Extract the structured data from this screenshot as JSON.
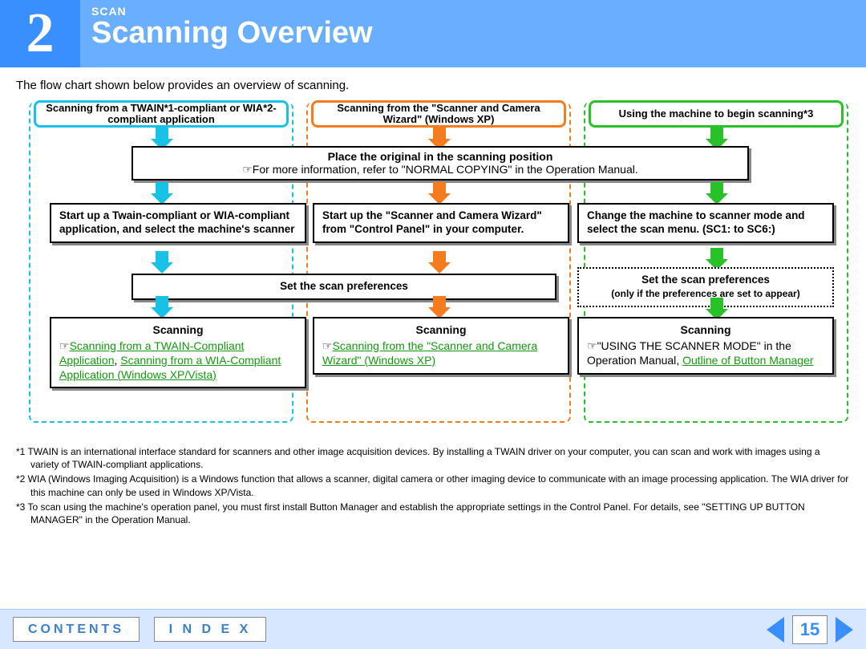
{
  "header": {
    "chapter_number": "2",
    "section": "SCAN",
    "title": "Scanning Overview"
  },
  "intro": "The flow chart shown below provides an overview of scanning.",
  "columns": {
    "col1_title": "Scanning from a TWAIN*1-compliant or WIA*2-compliant application",
    "col2_title": "Scanning from the \"Scanner and Camera Wizard\" (Windows XP)",
    "col3_title": "Using the machine to begin scanning*3"
  },
  "place": {
    "bold": "Place the original in the scanning position",
    "rest": "☞For more information, refer to \"NORMAL COPYING\" in the Operation Manual."
  },
  "step2": {
    "c1": "Start up a Twain-compliant or WIA-compliant application, and select the machine's scanner",
    "c2": "Start up the \"Scanner and Camera Wizard\" from \"Control Panel\" in your computer.",
    "c3": "Change the machine to scanner mode and select the scan menu. (SC1: to SC6:)"
  },
  "step3": {
    "shared": "Set the scan preferences",
    "c3_title": "Set the scan preferences",
    "c3_sub": "(only if the preferences are set to appear)"
  },
  "scan": {
    "title": "Scanning",
    "c1_hand": "☞",
    "c1_link1": "Scanning from a TWAIN-Compliant Application",
    "c1_sep": ", ",
    "c1_link2": "Scanning from a WIA-Compliant Application (Windows XP/Vista)",
    "c2_hand": "☞",
    "c2_link": "Scanning from the \"Scanner and Camera Wizard\" (Windows XP)",
    "c3_hand": "☞",
    "c3_text1": "\"USING THE SCANNER MODE\" in the Operation Manual,",
    "c3_link": "Outline of Button Manager"
  },
  "footnotes": {
    "f1": "*1 TWAIN is an international interface standard for scanners and other image acquisition devices. By installing a TWAIN driver on your computer, you can scan and work with images using a variety of TWAIN-compliant applications.",
    "f2": "*2 WIA (Windows Imaging Acquisition) is a Windows function that allows a scanner, digital camera or other imaging device to communicate with an image processing application. The WIA driver for this machine can only be used in Windows XP/Vista.",
    "f3": "*3 To scan using the machine's operation panel, you must first install Button Manager and establish the appropriate settings in the Control Panel. For details, see \"SETTING UP BUTTON MANAGER\" in the Operation Manual."
  },
  "footer": {
    "contents": "CONTENTS",
    "index": "I N D E X",
    "page": "15"
  }
}
